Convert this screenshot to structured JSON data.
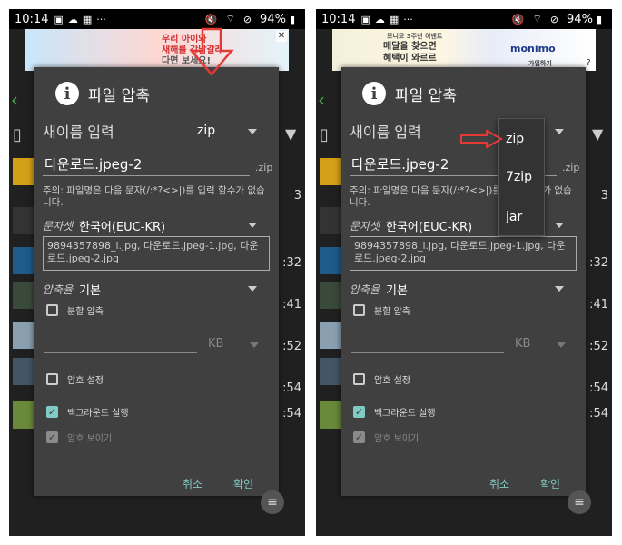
{
  "status": {
    "time": "10:14",
    "battery": "94%"
  },
  "ads": {
    "left": {
      "line1": "우리 아이와",
      "line2": "새해를 강남갈래",
      "line3": "다면 보세요!"
    },
    "right": {
      "line1": "모니모 3주년 이벤트",
      "line2": "매달을 찾으면",
      "line3": "혜택이 와르르",
      "brand": "monimo",
      "cta": "가입하기"
    }
  },
  "background": {
    "times": [
      "3",
      ":32",
      ":41",
      ":52",
      ":54",
      ":54"
    ]
  },
  "dialog": {
    "title": "파일 압축",
    "name_label": "새이름 입력",
    "format_value": "zip",
    "filename": "다운로드.jpeg-2",
    "suffix": ".zip",
    "note": "주의: 파일명은 다음 문자(/:*?<>|)를 입력 할수가 없습니다.",
    "charset_label": "문자셋",
    "charset_value": "한국어(EUC-KR)",
    "files": "9894357898_l.jpg, 다운로드.jpeg-1.jpg, 다운로드.jpeg-2.jpg",
    "level_label": "압축율",
    "level_value": "기본",
    "split_label": "분할 압축",
    "unit": "KB",
    "password_label": "암호 설정",
    "background_label": "백그라운드 실행",
    "show_password_label": "암호 보이기",
    "cancel": "취소",
    "confirm": "확인"
  },
  "format_options": [
    "zip",
    "7zip",
    "jar"
  ],
  "colors": {
    "accent": "#80cbc4",
    "arrow": "#e53935"
  }
}
